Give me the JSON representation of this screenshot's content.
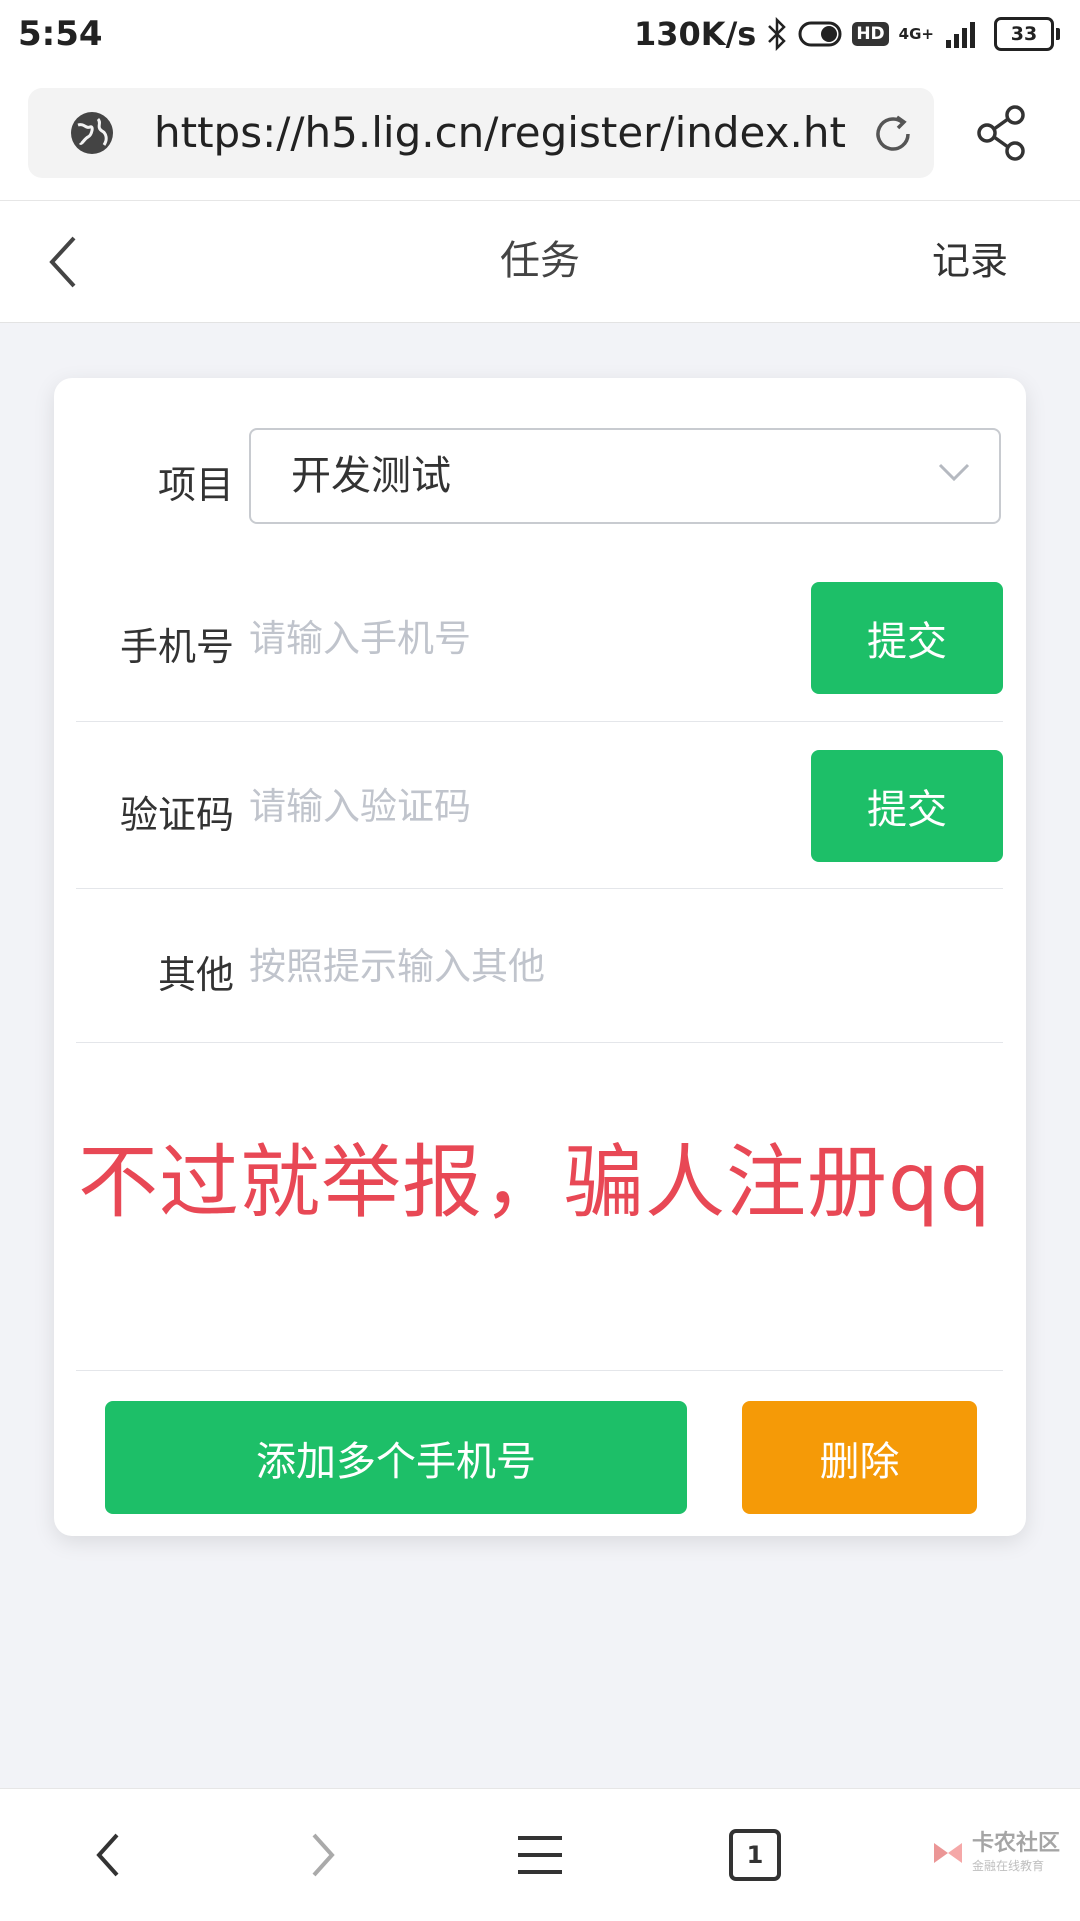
{
  "status_bar": {
    "time": "5:54",
    "net_speed": "130K/s",
    "hd": "HD",
    "net_type": "4G+",
    "battery": "33"
  },
  "browser": {
    "url": "https://h5.lig.cn/register/index.ht"
  },
  "header": {
    "title": "任务",
    "record_label": "记录"
  },
  "form": {
    "project_label": "项目",
    "project_value": "开发测试",
    "phone_label": "手机号",
    "phone_placeholder": "请输入手机号",
    "phone_submit": "提交",
    "code_label": "验证码",
    "code_placeholder": "请输入验证码",
    "code_submit": "提交",
    "other_label": "其他",
    "other_placeholder": "按照提示输入其他",
    "overlay_text": "不过就举报，骗人注册qq",
    "add_phones_button": "添加多个手机号",
    "delete_button": "删除"
  },
  "bottom_nav": {
    "tab_count": "1",
    "watermark_title": "卡农社区",
    "watermark_sub": "金融在线教育"
  },
  "colors": {
    "green": "#1dbf68",
    "orange": "#f59a07",
    "warning_red": "#e84855"
  }
}
